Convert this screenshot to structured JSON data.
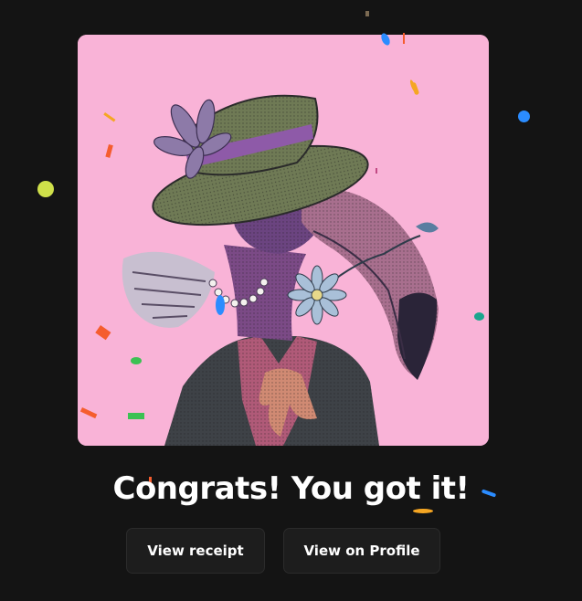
{
  "headline": "Congrats! You got it!",
  "buttons": {
    "view_receipt": "View receipt",
    "view_profile": "View on Profile"
  },
  "colors": {
    "background": "#141414",
    "card_background": "#f9b3d7",
    "button_background": "#1d1d1d",
    "text": "#ffffff"
  },
  "artwork": {
    "icon": "toucan-in-hat-illustration"
  }
}
